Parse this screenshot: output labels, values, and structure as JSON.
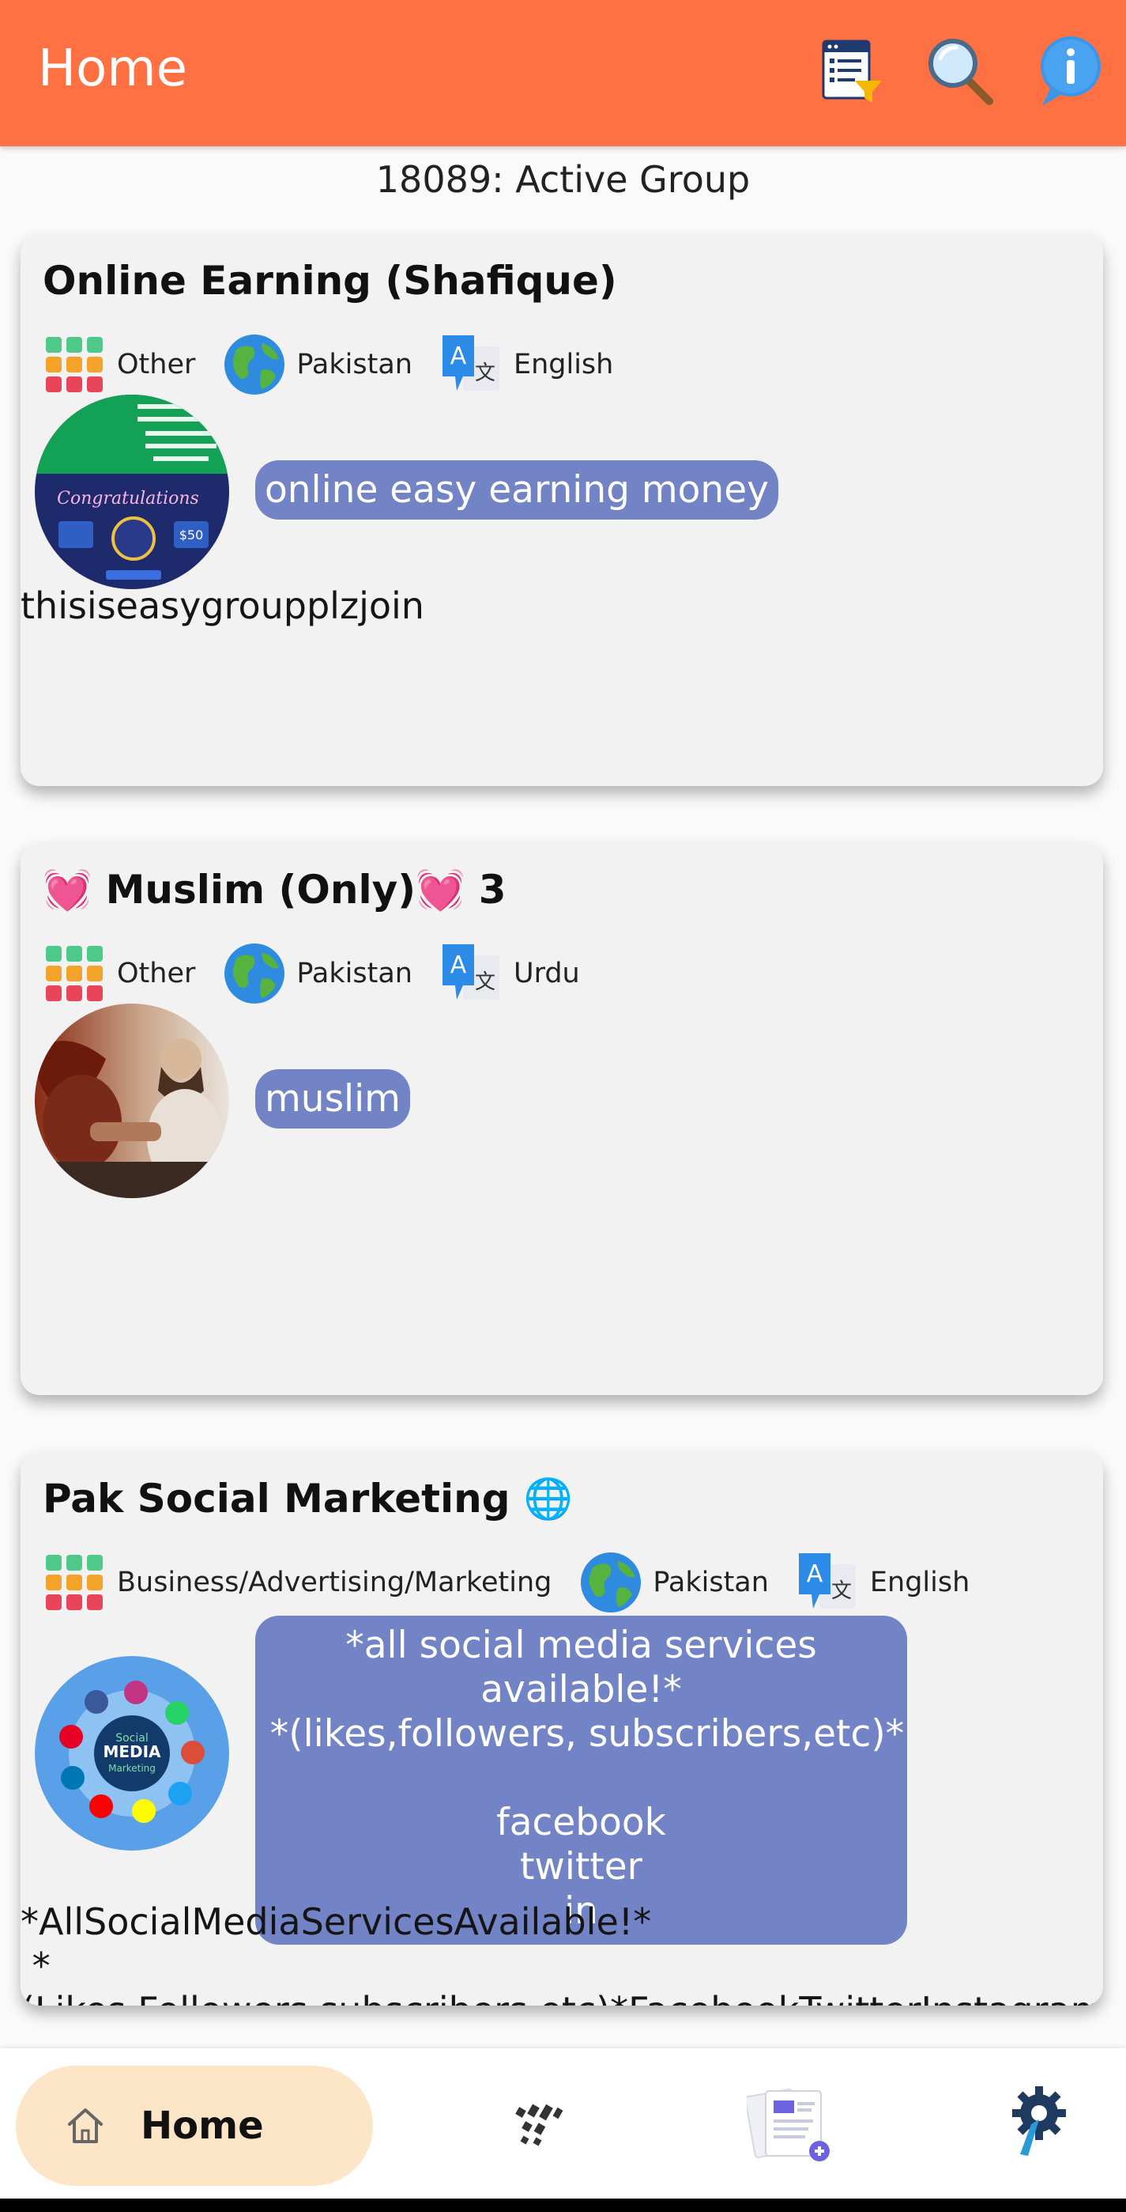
{
  "app": {
    "title": "Home"
  },
  "toolbar": {
    "icons": [
      "list-filter-icon",
      "search-icon",
      "info-icon"
    ]
  },
  "subtitle": "18089: Active Group",
  "cards": [
    {
      "title": "Online Earning (Shafique)",
      "category": "Other",
      "country": "Pakistan",
      "language": "English",
      "tagline": "online easy earning money",
      "description": "thisiseasygroupplzjoin"
    },
    {
      "title": "💓 Muslim (Only)💓 3",
      "category": "Other",
      "country": "Pakistan",
      "language": "Urdu",
      "tagline": "muslim",
      "description": ""
    },
    {
      "title": "Pak Social Marketing 🌐",
      "category": "Business/Advertising/Marketing",
      "country": "Pakistan",
      "language": "English",
      "tagline": "*all social media services available!*\n *(likes,followers, subscribers,etc)*\n\nfacebook\ntwitter\nin",
      "description": "*AllSocialMediaServicesAvailable!*\n *(Likes,Followers,subscribers,etc)*FacebookTwitterInstagram\nYouTubeTiktokHackingCourse"
    }
  ],
  "avatar_text": {
    "card1": [
      "Congratulations",
      "$50"
    ],
    "card3": [
      "Social",
      "MEDIA",
      "Marketing"
    ]
  },
  "bottom_nav": {
    "home_label": "Home",
    "items": [
      "home-icon",
      "categories-icon",
      "add-post-icon",
      "settings-icon"
    ]
  },
  "colors": {
    "appbar": "#ff7043",
    "bubble": "#7283c6",
    "home_pill": "#fde5c7",
    "card_bg": "#f2f2f2"
  }
}
